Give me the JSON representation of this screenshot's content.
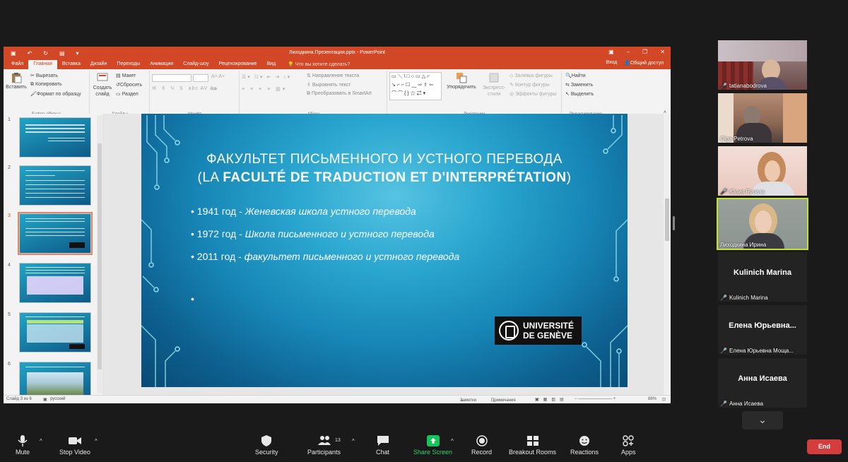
{
  "ppt": {
    "window_title": "Лиходкина.Презентация.pptx - PowerPoint",
    "tabs": [
      "Файл",
      "Главная",
      "Вставка",
      "Дизайн",
      "Переходы",
      "Анимация",
      "Слайд-шоу",
      "Рецензирование",
      "Вид"
    ],
    "active_tab": "Главная",
    "tell_me": "Что вы хотите сделать?",
    "sign_in": "Вход",
    "share": "Общий доступ",
    "ribbon": {
      "paste": "Вставить",
      "cut": "Вырезать",
      "copy": "Копировать",
      "format_painter": "Формат по образцу",
      "clipboard_group": "Буфер обмена",
      "new_slide": "Создать слайд",
      "layout": "Макет",
      "reset": "Сбросить",
      "section": "Раздел",
      "slides_group": "Слайды",
      "font_group": "Шрифт",
      "text_direction": "Направление текста",
      "align_text": "Выровнять текст",
      "smartart": "Преобразовать в SmartArt",
      "paragraph_group": "Абзац",
      "arrange": "Упорядочить",
      "quick_styles": "Экспресс-стили",
      "shape_fill": "Заливка фигуры",
      "shape_outline": "Контур фигуры",
      "shape_effects": "Эффекты фигуры",
      "drawing_group": "Рисование",
      "find": "Найти",
      "replace": "Заменить",
      "select": "Выделить",
      "editing_group": "Редактирование"
    },
    "thumbnail_numbers": [
      "1",
      "2",
      "3",
      "4",
      "5",
      "6"
    ],
    "slide": {
      "title_line1": "ФАКУЛЬТЕТ ПИСЬМЕННОГО И УСТНОГО ПЕРЕВОДА",
      "title_line2_open": "(LA ",
      "title_line2_bold": "FACULTÉ DE TRADUCTION ET D'INTERPRÉTATION",
      "title_line2_close": ")",
      "bullets": [
        {
          "year": "1941 год - ",
          "desc": "Женевская школа устного перевода"
        },
        {
          "year": "1972 год - ",
          "desc": " Школа письменного и устного перевода"
        },
        {
          "year": "2011 год - ",
          "desc": " факультет письменного и устного перевода"
        },
        {
          "year": "",
          "desc": ""
        }
      ],
      "logo_line1": "UNIVERSITÉ",
      "logo_line2": "DE GENÈVE"
    },
    "status": {
      "slide_of": "Слайд 3 из 6",
      "language": "русский",
      "notes": "Заметки",
      "comments": "Примечания",
      "zoom": "88%"
    }
  },
  "participants": [
    {
      "name": "tatianabodrova",
      "muted": true
    },
    {
      "name": "Olga Petrova",
      "muted": false
    },
    {
      "name": "Юлия Русина",
      "muted": true
    },
    {
      "name": "Лиходкина Ирина",
      "muted": false
    },
    {
      "big_name": "Kulinich Marina",
      "name": "Kulinich Marina",
      "muted": true
    },
    {
      "big_name": "Елена Юрьевна...",
      "name": "Елена Юрьевна Моща...",
      "muted": true
    },
    {
      "big_name": "Анна Исаева",
      "name": "Анна Исаева",
      "muted": true
    }
  ],
  "toolbar": {
    "mute": "Mute",
    "stop_video": "Stop Video",
    "security": "Security",
    "participants": "Participants",
    "participants_count": "13",
    "chat": "Chat",
    "share_screen": "Share Screen",
    "record": "Record",
    "breakout_rooms": "Breakout Rooms",
    "reactions": "Reactions",
    "apps": "Apps",
    "end": "End"
  }
}
